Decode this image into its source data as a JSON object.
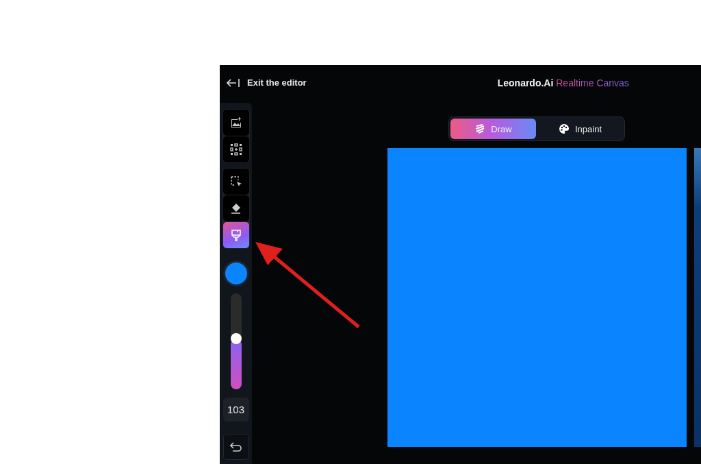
{
  "header": {
    "exit_label": "Exit the editor",
    "brand": "Leonardo.Ai",
    "product": "Realtime Canvas"
  },
  "tool_groups": [
    [
      {
        "kind": "add-image",
        "selected": false
      },
      {
        "kind": "grid",
        "selected": false
      }
    ],
    [
      {
        "kind": "select",
        "selected": false
      },
      {
        "kind": "eraser",
        "selected": false
      },
      {
        "kind": "brush",
        "selected": true
      }
    ]
  ],
  "brush_size": {
    "level": 0.52,
    "value": "103"
  },
  "modes": [
    {
      "label": "Draw",
      "kind": "draw",
      "selected": true
    },
    {
      "label": "Inpaint",
      "kind": "palette",
      "selected": false
    }
  ]
}
